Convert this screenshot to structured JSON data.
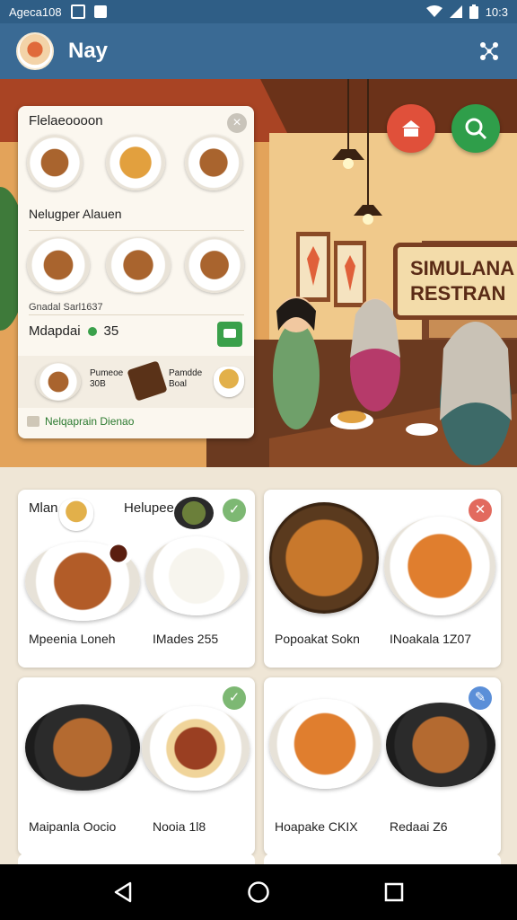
{
  "status_bar": {
    "left_text": "Ageca108",
    "time": "10:3"
  },
  "app_bar": {
    "title": "Nay"
  },
  "hero": {
    "sign_line1": "SIMULANA",
    "sign_line2": "RESTRAN"
  },
  "overlay_card": {
    "heading1": "Flelaeoooon",
    "heading2": "Nelugper Alauen",
    "small_text": "Gnadal Sarl1637",
    "row_label": "Mdapdai",
    "row_value": "35",
    "mini1_line1": "Pumeoe",
    "mini1_line2": "30B",
    "mini2_line1": "Pamdde",
    "mini2_line2": "Boal",
    "footer": "Nelqaprain Dienao"
  },
  "cards": [
    {
      "title_left": "Mlan",
      "title_right": "Helupee",
      "label_left": "Mpeenia Loneh",
      "label_right": "IMades 255",
      "badge": "✓"
    },
    {
      "label_left": "Popoakat Sokn",
      "label_right": "INoakala 1Z07",
      "badge": "✕"
    },
    {
      "label_left": "Maipanla Oocio",
      "label_right": "Nooia 1l8",
      "badge": "✓"
    },
    {
      "label_left": "Hoapake CKIX",
      "label_right": "Redaai Z6",
      "badge": "✎"
    }
  ],
  "icons": [
    "wifi-icon",
    "signal-icon",
    "battery-icon",
    "share-icon",
    "search-icon",
    "home-icon",
    "chat-icon",
    "back-icon",
    "circle-home-icon",
    "recents-icon"
  ],
  "colors": {
    "app_bar": "#3a6a94",
    "status_bar": "#2f5e86",
    "accent_green": "#3aa04a",
    "accent_red": "#e0503a"
  }
}
